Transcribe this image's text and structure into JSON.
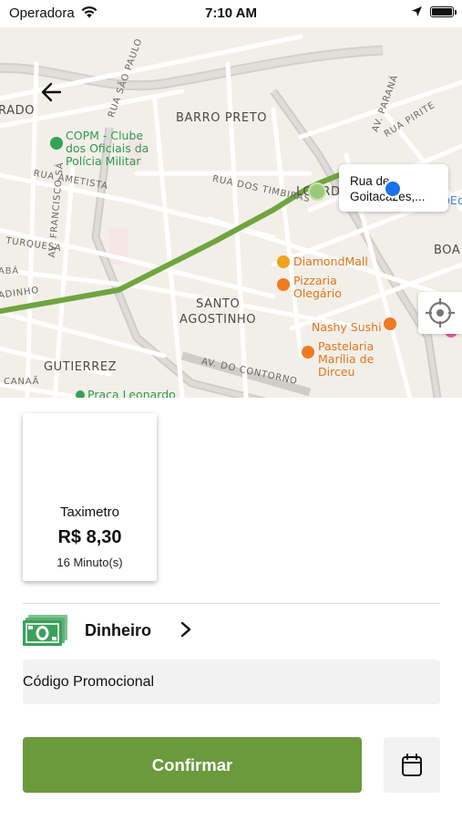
{
  "status_bar": {
    "carrier": "Operadora",
    "time": "7:10 AM"
  },
  "map": {
    "neighborhoods": [
      "RADO",
      "BARRO PRETO",
      "LOURDES",
      "SANTO",
      "AGOSTINHO",
      "GUTIERREZ",
      "BOA V"
    ],
    "streets": [
      "RUA AMETISTA",
      "RUA DOS TIMBIRAS",
      "TURQUESA",
      "AV. FRANCISCO SÁ",
      "AV. DO CONTORNO",
      "RUA PIRITE",
      "AV. PARANÁ",
      "RUA SÃO PAULO",
      "ABÁ",
      "ADINHO",
      "CANAÃ"
    ],
    "pois": {
      "copm": "COPM - Clube dos Oficiais da Polícia Militar",
      "diamond_mall": "DiamondMall",
      "pizzaria": "Pizzaria Olegário",
      "nashy_sushi": "Nashy Sushi",
      "pastelaria": "Pastelaria Marília de Dirceu",
      "praca": "Praça Leonardo",
      "edge_poi": "Ed"
    },
    "destination_callout": {
      "line1": "Rua de",
      "line2": "Goitacazes,..."
    },
    "route_color": "#6fa53e",
    "destination_pin_color": "#1a73e8"
  },
  "icons": {
    "back": "arrow-left-icon",
    "locate": "crosshair-icon",
    "payment": "cash-icon",
    "chevron": "chevron-right-icon",
    "schedule": "calendar-icon"
  },
  "fare": {
    "name": "Taximetro",
    "price": "R$ 8,30",
    "duration": "16 Minuto(s)"
  },
  "payment": {
    "method": "Dinheiro"
  },
  "promo": {
    "placeholder": "Código Promocional"
  },
  "actions": {
    "confirm_label": "Confirmar"
  },
  "colors": {
    "accent": "#6b9a3d",
    "cash_green": "#3aa05a",
    "field_bg": "#f2f2f2"
  }
}
